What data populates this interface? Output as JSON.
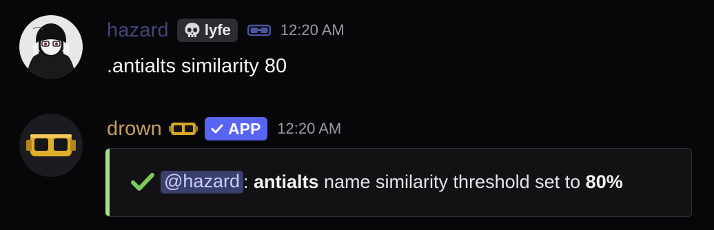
{
  "messages": [
    {
      "author": "hazard",
      "tag": "lyfe",
      "time": "12:20 AM",
      "content": ".antialts similarity 80"
    },
    {
      "author": "drown",
      "badge": "APP",
      "time": "12:20 AM",
      "embed": {
        "mention": "@hazard",
        "sep": ": ",
        "cmd": "antialts",
        "text": " name similarity threshold set to ",
        "value": "80%"
      }
    }
  ],
  "colors": {
    "background": "#070709",
    "hazard_name": "#404774",
    "drown_name": "#c8a15f",
    "app_badge": "#5865f2",
    "embed_accent": "#a5e088",
    "check": "#7cc95b",
    "mention_bg": "#3b3f6b"
  },
  "icons": {
    "tag_icon": "skull-icon",
    "hazard_decoration": "goggles-icon",
    "drown_decoration": "goggles-icon",
    "app_check": "checkmark-icon",
    "embed_check": "checkmark-icon"
  }
}
